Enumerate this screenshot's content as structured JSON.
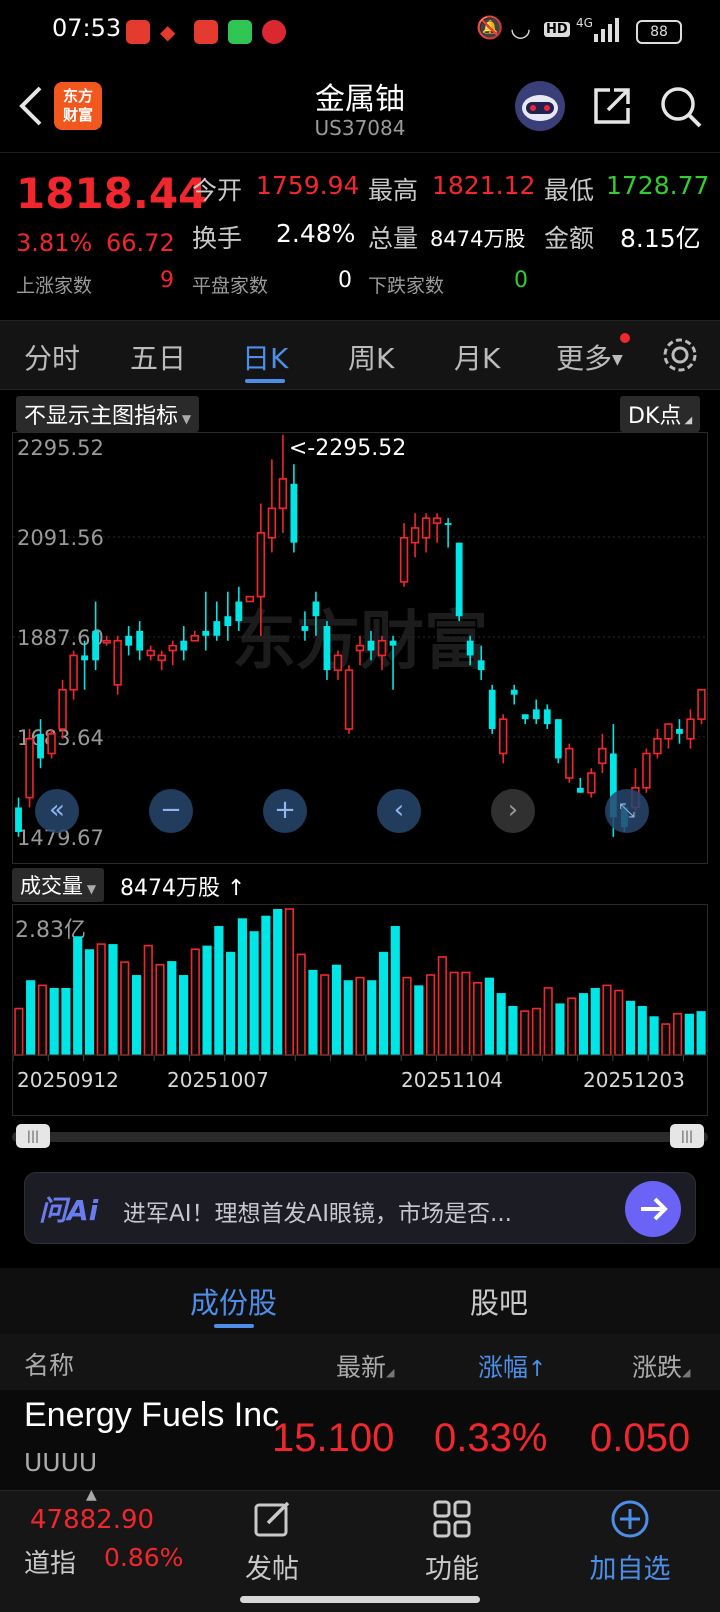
{
  "status": {
    "time": "07:53",
    "battery": "88",
    "hd": "HD",
    "net": "4G"
  },
  "header": {
    "title": "金属铀",
    "code": "US37084",
    "logo_line1": "东方",
    "logo_line2": "财富"
  },
  "quote": {
    "price": "1818.44",
    "pct": "3.81%",
    "change": "66.72",
    "open_label": "今开",
    "open": "1759.94",
    "high_label": "最高",
    "high": "1821.12",
    "low_label": "最低",
    "low": "1728.77",
    "turnover_label": "换手",
    "turnover": "2.48%",
    "volume_label": "总量",
    "volume": "8474万股",
    "amount_label": "金额",
    "amount": "8.15亿",
    "up_label": "上涨家数",
    "up": "9",
    "flat_label": "平盘家数",
    "flat": "0",
    "down_label": "下跌家数",
    "down": "0"
  },
  "tabs": [
    "分时",
    "五日",
    "日K",
    "周K",
    "月K",
    "更多"
  ],
  "chart_controls": {
    "indicator": "不显示主图指标",
    "dk": "DK点",
    "volume_selector": "成交量",
    "volume_value": "8474万股",
    "volume_arrow": "↑"
  },
  "colors": {
    "up": "#f0272c",
    "down": "#00e5e5",
    "accent": "#4d8ee8"
  },
  "chart_data": {
    "type": "candlestick",
    "y_ticks": [
      "2295.52",
      "2091.56",
      "1887.60",
      "1683.64",
      "1479.67"
    ],
    "ylim": [
      1479.67,
      2295.52
    ],
    "max_label": "<-2295.52",
    "min_label": "1479.67->",
    "volume_tick": "2.83亿",
    "volume_max": 2.83,
    "x_labels": [
      "20250912",
      "20251007",
      "20251104",
      "20251203"
    ],
    "watermark": "东方财富",
    "candles": [
      [
        1490,
        1540,
        1480,
        1560,
        0
      ],
      [
        1560,
        1680,
        1540,
        1700,
        1
      ],
      [
        1690,
        1640,
        1620,
        1720,
        0
      ],
      [
        1650,
        1690,
        1640,
        1700,
        1
      ],
      [
        1700,
        1780,
        1680,
        1800,
        1
      ],
      [
        1780,
        1850,
        1760,
        1860,
        1
      ],
      [
        1850,
        1840,
        1780,
        1880,
        0
      ],
      [
        1840,
        1900,
        1820,
        1960,
        0
      ],
      [
        1880,
        1880,
        1870,
        1890,
        1
      ],
      [
        1880,
        1790,
        1770,
        1890,
        1
      ],
      [
        1870,
        1890,
        1850,
        1910,
        0
      ],
      [
        1900,
        1860,
        1840,
        1920,
        0
      ],
      [
        1850,
        1860,
        1840,
        1870,
        1
      ],
      [
        1850,
        1840,
        1820,
        1860,
        1
      ],
      [
        1860,
        1870,
        1830,
        1880,
        1
      ],
      [
        1860,
        1880,
        1840,
        1910,
        0
      ],
      [
        1880,
        1890,
        1880,
        1900,
        1
      ],
      [
        1890,
        1900,
        1860,
        1980,
        0
      ],
      [
        1890,
        1920,
        1880,
        1960,
        0
      ],
      [
        1910,
        1930,
        1880,
        1980,
        0
      ],
      [
        1920,
        1960,
        1900,
        1990,
        0
      ],
      [
        1960,
        1970,
        1960,
        1970,
        1
      ],
      [
        1970,
        2100,
        1890,
        2160,
        1
      ],
      [
        2090,
        2150,
        2060,
        2250,
        1
      ],
      [
        2150,
        2210,
        2100,
        2300,
        1
      ],
      [
        2200,
        2080,
        2060,
        2240,
        0
      ],
      [
        1910,
        1900,
        1880,
        1940,
        0
      ],
      [
        1930,
        1960,
        1890,
        1980,
        0
      ],
      [
        1910,
        1820,
        1800,
        1920,
        0
      ],
      [
        1820,
        1850,
        1800,
        1860,
        1
      ],
      [
        1820,
        1700,
        1690,
        1830,
        1
      ],
      [
        1860,
        1870,
        1830,
        1890,
        1
      ],
      [
        1860,
        1880,
        1840,
        1900,
        0
      ],
      [
        1850,
        1880,
        1820,
        1890,
        1
      ],
      [
        1880,
        1870,
        1780,
        1890,
        0
      ],
      [
        2000,
        2090,
        1990,
        2120,
        1
      ],
      [
        2080,
        2110,
        2050,
        2140,
        1
      ],
      [
        2090,
        2130,
        2060,
        2140,
        1
      ],
      [
        2130,
        2120,
        2080,
        2140,
        1
      ],
      [
        2120,
        2120,
        2070,
        2130,
        0
      ],
      [
        2080,
        1930,
        1920,
        2080,
        0
      ],
      [
        1880,
        1850,
        1830,
        1890,
        0
      ],
      [
        1840,
        1820,
        1800,
        1870,
        0
      ],
      [
        1780,
        1700,
        1690,
        1790,
        0
      ],
      [
        1650,
        1720,
        1630,
        1730,
        1
      ],
      [
        1780,
        1770,
        1750,
        1790,
        0
      ],
      [
        1730,
        1720,
        1710,
        1730,
        0
      ],
      [
        1720,
        1740,
        1710,
        1760,
        0
      ],
      [
        1740,
        1710,
        1700,
        1750,
        0
      ],
      [
        1720,
        1640,
        1630,
        1720,
        0
      ],
      [
        1600,
        1660,
        1590,
        1670,
        1
      ],
      [
        1580,
        1570,
        1570,
        1600,
        0
      ],
      [
        1570,
        1610,
        1560,
        1620,
        1
      ],
      [
        1630,
        1660,
        1610,
        1690,
        1
      ],
      [
        1650,
        1520,
        1480,
        1710,
        0
      ],
      [
        1500,
        1540,
        1490,
        1550,
        0
      ],
      [
        1540,
        1580,
        1520,
        1620,
        1
      ],
      [
        1580,
        1650,
        1570,
        1660,
        1
      ],
      [
        1650,
        1680,
        1640,
        1700,
        1
      ],
      [
        1680,
        1710,
        1660,
        1710,
        1
      ],
      [
        1700,
        1690,
        1670,
        1720,
        0
      ],
      [
        1680,
        1720,
        1660,
        1740,
        1
      ],
      [
        1720,
        1780,
        1710,
        1780,
        1
      ]
    ],
    "volumes": [
      [
        0.9,
        0
      ],
      [
        1.45,
        1
      ],
      [
        1.35,
        0
      ],
      [
        1.3,
        1
      ],
      [
        1.3,
        1
      ],
      [
        2.3,
        1
      ],
      [
        2.05,
        1
      ],
      [
        2.15,
        0
      ],
      [
        2.15,
        1
      ],
      [
        1.8,
        0
      ],
      [
        1.55,
        1
      ],
      [
        2.12,
        0
      ],
      [
        1.75,
        0
      ],
      [
        1.82,
        1
      ],
      [
        1.55,
        1
      ],
      [
        2.05,
        0
      ],
      [
        2.12,
        1
      ],
      [
        2.5,
        1
      ],
      [
        2.0,
        1
      ],
      [
        2.65,
        1
      ],
      [
        2.4,
        1
      ],
      [
        2.7,
        1
      ],
      [
        2.83,
        1
      ],
      [
        2.83,
        0
      ],
      [
        1.95,
        0
      ],
      [
        1.65,
        1
      ],
      [
        1.55,
        0
      ],
      [
        1.75,
        1
      ],
      [
        1.45,
        1
      ],
      [
        1.5,
        0
      ],
      [
        1.45,
        1
      ],
      [
        2.0,
        1
      ],
      [
        2.5,
        1
      ],
      [
        1.5,
        0
      ],
      [
        1.35,
        1
      ],
      [
        1.55,
        0
      ],
      [
        1.9,
        0
      ],
      [
        1.6,
        0
      ],
      [
        1.6,
        0
      ],
      [
        1.4,
        0
      ],
      [
        1.5,
        1
      ],
      [
        1.2,
        1
      ],
      [
        0.95,
        1
      ],
      [
        0.85,
        0
      ],
      [
        0.9,
        0
      ],
      [
        1.3,
        0
      ],
      [
        1.0,
        1
      ],
      [
        1.1,
        0
      ],
      [
        1.2,
        1
      ],
      [
        1.3,
        1
      ],
      [
        1.35,
        0
      ],
      [
        1.25,
        0
      ],
      [
        1.05,
        1
      ],
      [
        0.95,
        1
      ],
      [
        0.75,
        1
      ],
      [
        0.6,
        0
      ],
      [
        0.8,
        0
      ],
      [
        0.8,
        1
      ],
      [
        0.85,
        1
      ]
    ]
  },
  "ai": {
    "logo": "问Ai",
    "text": "进军AI！理想首发AI眼镜，市场是否..."
  },
  "subtabs": [
    "成份股",
    "股吧"
  ],
  "list": {
    "col_name": "名称",
    "col_latest": "最新",
    "col_pct": "涨幅",
    "col_chg": "涨跌",
    "row": {
      "name": "Energy Fuels Inc",
      "code": "UUUU",
      "latest": "15.100",
      "pct": "0.33%",
      "chg": "0.050"
    }
  },
  "bottom": {
    "index_value": "47882.90",
    "index_name": "道指",
    "index_pct": "0.86%",
    "post": "发帖",
    "func": "功能",
    "add": "加自选"
  }
}
